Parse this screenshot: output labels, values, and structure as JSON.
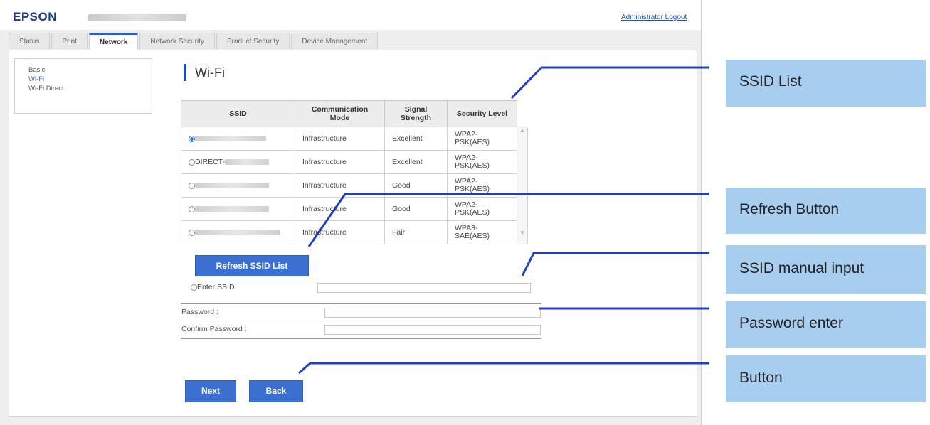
{
  "header": {
    "logo": "EPSON",
    "logout": "Administrator Logout"
  },
  "tabs": [
    "Status",
    "Print",
    "Network",
    "Network Security",
    "Product Security",
    "Device Management"
  ],
  "active_tab": "Network",
  "sidebar": {
    "items": [
      "Basic",
      "Wi-Fi",
      "Wi-Fi Direct"
    ],
    "current": "Wi-Fi"
  },
  "page": {
    "title": "Wi-Fi"
  },
  "table": {
    "headers": {
      "ssid": "SSID",
      "mode_line1": "Communication",
      "mode_line2": "Mode",
      "signal_line1": "Signal",
      "signal_line2": "Strength",
      "security": "Security Level"
    },
    "rows": [
      {
        "ssid_prefix": "",
        "mode": "Infrastructure",
        "signal": "Excellent",
        "security_line1": "WPA2-",
        "security_line2": "PSK(AES)",
        "selected": true
      },
      {
        "ssid_prefix": "DIRECT-",
        "mode": "Infrastructure",
        "signal": "Excellent",
        "security_line1": "WPA2-",
        "security_line2": "PSK(AES)",
        "selected": false
      },
      {
        "ssid_prefix": "",
        "mode": "Infrastructure",
        "signal": "Good",
        "security_line1": "WPA2-",
        "security_line2": "PSK(AES)",
        "selected": false
      },
      {
        "ssid_prefix": "",
        "mode": "Infrastructure",
        "signal": "Good",
        "security_line1": "WPA2-",
        "security_line2": "PSK(AES)",
        "selected": false
      },
      {
        "ssid_prefix": "",
        "mode": "Infrastructure",
        "signal": "Fair",
        "security_line1": "WPA3-",
        "security_line2": "SAE(AES)",
        "selected": false
      }
    ]
  },
  "buttons": {
    "refresh": "Refresh SSID List",
    "next": "Next",
    "back": "Back"
  },
  "form": {
    "enter_ssid": "Enter SSID",
    "password": "Password :",
    "confirm_password": "Confirm Password :"
  },
  "callouts": {
    "ssid_list": "SSID List",
    "refresh": "Refresh Button",
    "manual": "SSID manual input",
    "password": "Password enter",
    "button": "Button"
  },
  "colors": {
    "accent": "#3b6fd0",
    "callout_bg": "#a7cdef",
    "leader_line": "#1f3fbf",
    "logo": "#1c3b8f"
  }
}
